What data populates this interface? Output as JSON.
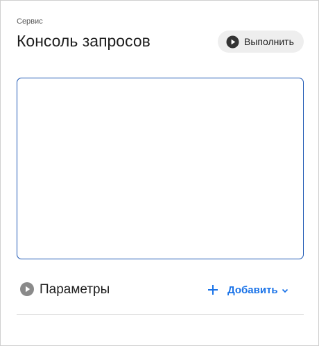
{
  "header": {
    "service_label": "Сервис",
    "title": "Консоль запросов",
    "run_button_label": "Выполнить"
  },
  "editor": {
    "value": ""
  },
  "parameters": {
    "label": "Параметры",
    "add_label": "Добавить"
  },
  "icons": {
    "run": "play-circle-icon",
    "params_toggle": "play-circle-icon",
    "add": "plus-icon",
    "add_menu": "chevron-down-icon"
  },
  "colors": {
    "accent": "#1a73e8",
    "editor_border": "#1b56b3",
    "run_icon": "#333333",
    "params_icon": "#8a8a8a",
    "button_bg": "#eeeeee"
  }
}
